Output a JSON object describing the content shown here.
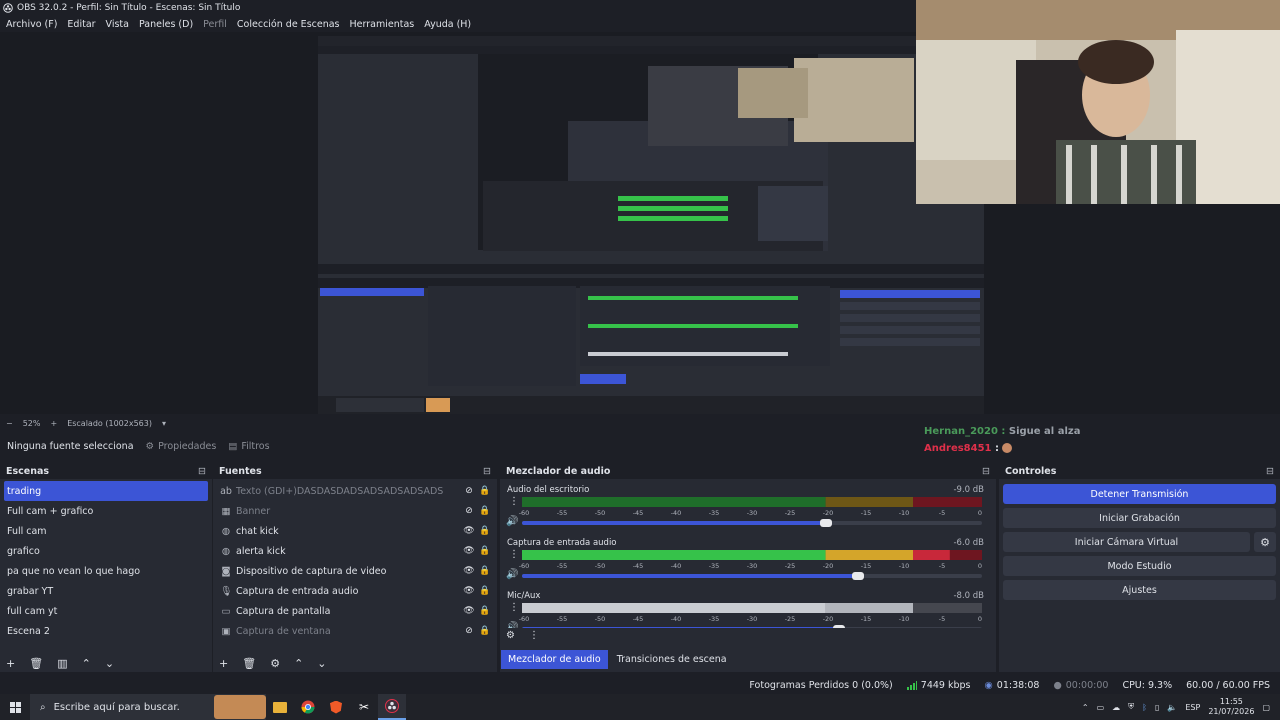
{
  "window": {
    "title": "OBS 32.0.2 - Perfil: Sin Título - Escenas: Sin Título"
  },
  "menu": [
    {
      "label": "Archivo (F)",
      "enabled": true
    },
    {
      "label": "Editar",
      "enabled": true
    },
    {
      "label": "Vista",
      "enabled": true
    },
    {
      "label": "Paneles (D)",
      "enabled": true
    },
    {
      "label": "Perfil",
      "enabled": false
    },
    {
      "label": "Colección de Escenas",
      "enabled": true
    },
    {
      "label": "Herramientas",
      "enabled": true
    },
    {
      "label": "Ayuda (H)",
      "enabled": true
    }
  ],
  "preview": {
    "zoom": "52%",
    "scaling": "Escalado (1002x563)"
  },
  "source_bar": {
    "no_source": "Ninguna fuente selecciona",
    "properties": "Propiedades",
    "filters": "Filtros"
  },
  "chat": [
    {
      "user": "Hernan_2020",
      "sep": " : ",
      "message": "Sigue al alza",
      "color": "#4a9a5a"
    },
    {
      "user": "Andres8451",
      "sep": " : ",
      "message": "",
      "color": "#e0304a"
    }
  ],
  "scenes": {
    "title": "Escenas",
    "items": [
      "trading",
      "Full cam + grafico",
      "Full cam",
      "grafico",
      "pa que no vean lo que hago",
      "grabar YT",
      "full cam yt",
      "Escena 2"
    ],
    "selected_index": 0
  },
  "sources": {
    "title": "Fuentes",
    "items": [
      {
        "name": "Texto (GDI+)DASDASDADSADSADSADSADS",
        "icon": "text-icon",
        "visible": false
      },
      {
        "name": "Banner",
        "icon": "image-icon",
        "visible": false
      },
      {
        "name": "chat kick",
        "icon": "browser-icon",
        "visible": true
      },
      {
        "name": "alerta kick",
        "icon": "browser-icon",
        "visible": true
      },
      {
        "name": "Dispositivo de captura de video",
        "icon": "camera-icon",
        "visible": true
      },
      {
        "name": "Captura de entrada audio",
        "icon": "microphone-icon",
        "visible": true
      },
      {
        "name": "Captura de pantalla",
        "icon": "monitor-icon",
        "visible": true
      },
      {
        "name": "Captura de ventana",
        "icon": "window-icon",
        "visible": false
      }
    ]
  },
  "mixer": {
    "title": "Mezclador de audio",
    "scale": [
      "-60",
      "-55",
      "-50",
      "-45",
      "-40",
      "-35",
      "-30",
      "-25",
      "-20",
      "-15",
      "-10",
      "-5",
      "0"
    ],
    "tracks": [
      {
        "name": "Audio del escritorio",
        "db": "-9.0 dB",
        "level": 0.0,
        "volume": 0.66,
        "active": false
      },
      {
        "name": "Captura de entrada audio",
        "db": "-6.0 dB",
        "level": 0.93,
        "volume": 0.73,
        "active": true
      },
      {
        "name": "Mic/Aux",
        "db": "-8.0 dB",
        "level": 0.85,
        "volume": 0.69,
        "active": false
      }
    ],
    "tabs": [
      "Mezclador de audio",
      "Transiciones de escena"
    ]
  },
  "controls": {
    "title": "Controles",
    "stop_stream": "Detener Transmisión",
    "start_recording": "Iniciar Grabación",
    "start_virtual_cam": "Iniciar Cámara Virtual",
    "studio_mode": "Modo Estudio",
    "settings": "Ajustes"
  },
  "status": {
    "dropped": "Fotogramas Perdidos 0 (0.0%)",
    "bitrate": "7449 kbps",
    "stream_time": "01:38:08",
    "rec_time": "00:00:00",
    "cpu": "CPU: 9.3%",
    "fps": "60.00 / 60.00 FPS"
  },
  "taskbar": {
    "search_placeholder": "Escribe aquí para buscar.",
    "language": "ESP",
    "time": "11:55",
    "date": "21/07/2026"
  },
  "colors": {
    "accent": "#3c55d6",
    "meter_green": "#36c24a",
    "meter_yellow": "#d4a52a",
    "meter_red": "#c8283a"
  }
}
